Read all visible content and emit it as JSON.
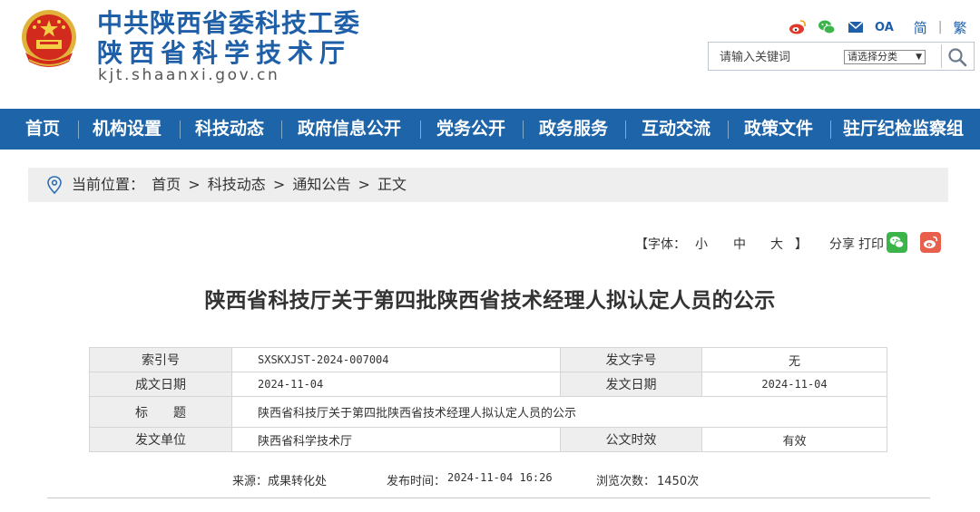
{
  "header": {
    "title_line1": "中共陕西省委科技工委",
    "title_line2": "陕西省科学技术厅",
    "domain": "kjt.shaanxi.gov.cn",
    "oa_label": "OA",
    "lang_simplified": "简",
    "lang_separator": "|",
    "lang_traditional": "繁",
    "icons": [
      "weibo-icon",
      "wechat-icon",
      "mail-icon"
    ]
  },
  "search": {
    "placeholder": "请输入关键词",
    "category_select": "请选择分类"
  },
  "nav": {
    "items": [
      "首页",
      "机构设置",
      "科技动态",
      "政府信息公开",
      "党务公开",
      "政务服务",
      "互动交流",
      "政策文件",
      "驻厅纪检监察组"
    ]
  },
  "breadcrumb": {
    "prefix": "当前位置：",
    "items": [
      "首页",
      "科技动态",
      "通知公告",
      "正文"
    ],
    "separator": ">"
  },
  "tools": {
    "font_open": "【字体：",
    "font_small": "小",
    "font_medium": "中",
    "font_large": "大",
    "font_close": "】",
    "share_label": "分享",
    "print_label": "打印"
  },
  "article": {
    "title": "陕西省科技厅关于第四批陕西省技术经理人拟认定人员的公示",
    "meta": {
      "index_label": "索引号",
      "index_value": "SXSKXJST-2024-007004",
      "doc_no_label": "发文字号",
      "doc_no_value": "无",
      "written_date_label": "成文日期",
      "written_date_value": "2024-11-04",
      "issue_date_label": "发文日期",
      "issue_date_value": "2024-11-04",
      "title_label": "标　　题",
      "title_value": "陕西省科技厅关于第四批陕西省技术经理人拟认定人员的公示",
      "issuer_label": "发文单位",
      "issuer_value": "陕西省科学技术厅",
      "validity_label": "公文时效",
      "validity_value": "有效"
    },
    "source_label": "来源：",
    "source_value": "成果转化处",
    "publish_label": "发布时间：",
    "publish_value": "2024-11-04 16:26",
    "views_label": "浏览次数：",
    "views_value": "1450次"
  },
  "colors": {
    "brand_blue": "#1e64a8",
    "wechat_green": "#3bb54a",
    "weibo_red": "#e8604c"
  }
}
